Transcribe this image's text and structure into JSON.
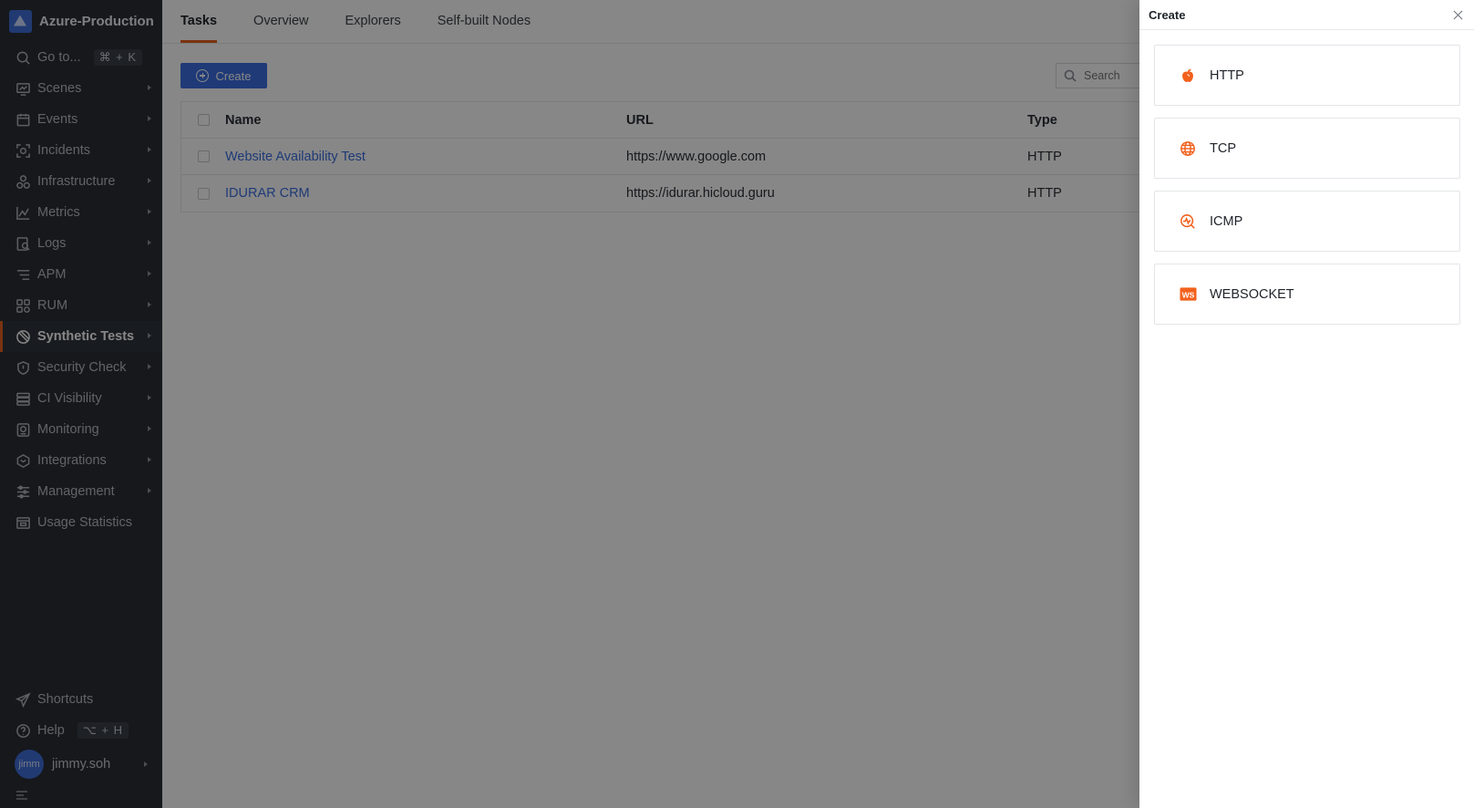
{
  "workspace": {
    "name": "Azure-Production"
  },
  "sidebar": {
    "goto": {
      "label": "Go to...",
      "shortcut": "⌘ + K"
    },
    "items": [
      {
        "label": "Scenes",
        "icon": "scenes-icon"
      },
      {
        "label": "Events",
        "icon": "events-icon"
      },
      {
        "label": "Incidents",
        "icon": "incidents-icon"
      },
      {
        "label": "Infrastructure",
        "icon": "infrastructure-icon"
      },
      {
        "label": "Metrics",
        "icon": "metrics-icon"
      },
      {
        "label": "Logs",
        "icon": "logs-icon"
      },
      {
        "label": "APM",
        "icon": "apm-icon"
      },
      {
        "label": "RUM",
        "icon": "rum-icon"
      },
      {
        "label": "Synthetic Tests",
        "icon": "synthetic-tests-icon",
        "active": true
      },
      {
        "label": "Security Check",
        "icon": "security-check-icon"
      },
      {
        "label": "CI Visibility",
        "icon": "ci-visibility-icon"
      },
      {
        "label": "Monitoring",
        "icon": "monitoring-icon"
      },
      {
        "label": "Integrations",
        "icon": "integrations-icon"
      },
      {
        "label": "Management",
        "icon": "management-icon"
      },
      {
        "label": "Usage Statistics",
        "icon": "usage-statistics-icon"
      }
    ],
    "shortcuts": {
      "label": "Shortcuts"
    },
    "help": {
      "label": "Help",
      "shortcut": "⌥ + H"
    },
    "user": {
      "avatar": "jimm",
      "name": "jimmy.soh"
    }
  },
  "main": {
    "tabs": [
      {
        "label": "Tasks",
        "active": true
      },
      {
        "label": "Overview"
      },
      {
        "label": "Explorers"
      },
      {
        "label": "Self-built Nodes"
      }
    ],
    "create_button": "Create",
    "search": {
      "placeholder": "Search",
      "value": ""
    },
    "table": {
      "columns": [
        "Name",
        "URL",
        "Type"
      ],
      "rows": [
        {
          "name": "Website Availability Test",
          "url": "https://www.google.com",
          "type": "HTTP"
        },
        {
          "name": "IDURAR CRM",
          "url": "https://idurar.hicloud.guru",
          "type": "HTTP"
        }
      ]
    }
  },
  "drawer": {
    "title": "Create",
    "options": [
      {
        "label": "HTTP",
        "icon": "http-icon"
      },
      {
        "label": "TCP",
        "icon": "tcp-globe-icon"
      },
      {
        "label": "ICMP",
        "icon": "icmp-pulse-icon"
      },
      {
        "label": "WEBSOCKET",
        "icon": "websocket-ws-icon",
        "badge": "WS"
      }
    ],
    "accent_color": "#f2611d"
  },
  "colors": {
    "accent": "#e4611f",
    "primary": "#3b6fe0",
    "sidebar": "#2b2f36"
  }
}
